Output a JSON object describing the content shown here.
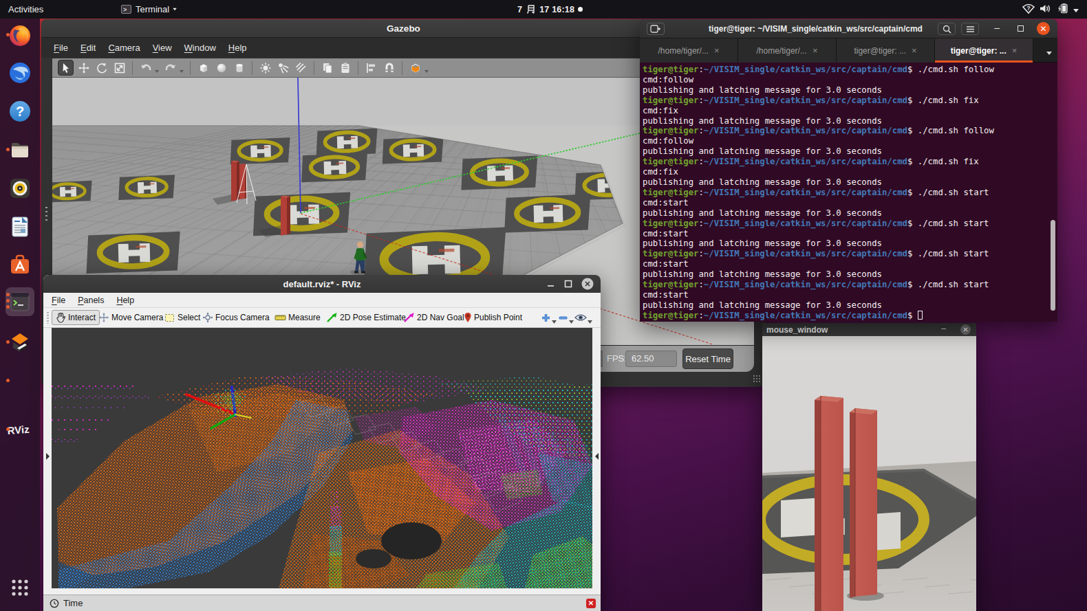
{
  "top_bar": {
    "activities": "Activities",
    "app_menu": {
      "icon": "terminal-icon",
      "label": "Terminal",
      "caret": "dropdown"
    },
    "clock": "7月 17 16:18",
    "recording_dot": true,
    "tray_icons": [
      "wifi-question-icon",
      "volume-icon",
      "battery-icon",
      "dropdown-caret-icon"
    ]
  },
  "dock": {
    "items": [
      {
        "id": "firefox",
        "icon": "firefox-icon",
        "running": true,
        "windows": 1,
        "active": false
      },
      {
        "id": "thunderbird",
        "icon": "thunderbird-icon",
        "running": false,
        "windows": 0,
        "active": false
      },
      {
        "id": "help",
        "icon": "help-icon",
        "running": false,
        "windows": 0,
        "active": false
      },
      {
        "id": "files",
        "icon": "files-icon",
        "running": true,
        "windows": 1,
        "active": false
      },
      {
        "id": "rhythmbox",
        "icon": "rhythmbox-icon",
        "running": false,
        "windows": 0,
        "active": false
      },
      {
        "id": "libreoffice-writer",
        "icon": "writer-icon",
        "running": false,
        "windows": 0,
        "active": false
      },
      {
        "id": "ubuntu-software",
        "icon": "software-icon",
        "running": false,
        "windows": 0,
        "active": false
      },
      {
        "id": "terminal",
        "icon": "terminal-app-icon",
        "running": true,
        "windows": 3,
        "active": true
      },
      {
        "id": "gazebo",
        "icon": "gazebo-icon",
        "running": true,
        "windows": 1,
        "active": false
      },
      {
        "id": "unknown-app",
        "icon": "blank-icon",
        "running": true,
        "windows": 1,
        "active": false
      },
      {
        "id": "rviz",
        "icon": "rviz-icon",
        "running": true,
        "windows": 1,
        "active": false
      }
    ],
    "show_apps_icon": "show-apps-grid-icon"
  },
  "gazebo_window": {
    "title": "Gazebo",
    "menus": [
      "File",
      "Edit",
      "Camera",
      "View",
      "Window",
      "Help"
    ],
    "toolbar_tools": [
      "select-arrow",
      "translate",
      "rotate",
      "scale",
      "sep",
      "undo",
      "drop",
      "redo",
      "drop",
      "sep",
      "box",
      "sphere",
      "cylinder",
      "sep",
      "point-light",
      "spot-light",
      "directional-light",
      "sep",
      "copy",
      "paste",
      "sep",
      "align",
      "snap",
      "sep",
      "view-angle",
      "drop"
    ],
    "selected_tool": "select-arrow",
    "status_bar": {
      "fps_label": "FPS:",
      "fps_value": "62.50",
      "reset_button": "Reset Time"
    }
  },
  "rviz_window": {
    "title": "default.rviz* - RViz",
    "window_buttons": [
      "minimize",
      "maximize",
      "close"
    ],
    "menus": [
      "File",
      "Panels",
      "Help"
    ],
    "tools": [
      {
        "label": "Interact",
        "icon": "hand-icon",
        "active": true
      },
      {
        "label": "Move Camera",
        "icon": "move-camera-icon",
        "active": false
      },
      {
        "label": "Select",
        "icon": "select-box-icon",
        "active": false
      },
      {
        "label": "Focus Camera",
        "icon": "focus-camera-icon",
        "active": false
      },
      {
        "label": "Measure",
        "icon": "measure-icon",
        "active": false
      },
      {
        "label": "2D Pose Estimate",
        "icon": "green-arrow-icon",
        "active": false
      },
      {
        "label": "2D Nav Goal",
        "icon": "magenta-arrow-icon",
        "active": false
      },
      {
        "label": "Publish Point",
        "icon": "publish-point-icon",
        "active": false
      }
    ],
    "toolbar_extra": [
      "add-tool-plus-icon",
      "remove-tool-minus-icon",
      "interaction-eye-icon"
    ],
    "time_panel": {
      "label": "Time",
      "icon": "clock-icon",
      "close_icon": "panel-close-icon"
    }
  },
  "terminal_window": {
    "header": {
      "title": "tiger@tiger: ~/VISIM_single/catkin_ws/src/captain/cmd",
      "buttons": [
        "new-tab",
        "search",
        "menu",
        "minimize",
        "maximize",
        "close"
      ]
    },
    "tabs": [
      {
        "label": "/home/tiger/...",
        "close": "×",
        "active": false
      },
      {
        "label": "/home/tiger/...",
        "close": "×",
        "active": false
      },
      {
        "label": "tiger@tiger: ...",
        "close": "×",
        "active": false
      },
      {
        "label": "tiger@tiger: ...",
        "close": "×",
        "active": true
      }
    ],
    "prompt": {
      "user": "tiger@tiger",
      "separator": ":",
      "path": "~/VISIM_single/catkin_ws/src/captain/cmd",
      "dollar": "$"
    },
    "entries": [
      {
        "command": "./cmd.sh follow",
        "echo": "cmd:follow",
        "publish": "publishing and latching message for 3.0 seconds"
      },
      {
        "command": "./cmd.sh fix",
        "echo": "cmd:fix",
        "publish": "publishing and latching message for 3.0 seconds"
      },
      {
        "command": "./cmd.sh follow",
        "echo": "cmd:follow",
        "publish": "publishing and latching message for 3.0 seconds"
      },
      {
        "command": "./cmd.sh fix",
        "echo": "cmd:fix",
        "publish": "publishing and latching message for 3.0 seconds"
      },
      {
        "command": "./cmd.sh start",
        "echo": "cmd:start",
        "publish": "publishing and latching message for 3.0 seconds"
      },
      {
        "command": "./cmd.sh start",
        "echo": "cmd:start",
        "publish": "publishing and latching message for 3.0 seconds"
      },
      {
        "command": "./cmd.sh start",
        "echo": "cmd:start",
        "publish": "publishing and latching message for 3.0 seconds"
      },
      {
        "command": "./cmd.sh start",
        "echo": "cmd:start",
        "publish": "publishing and latching message for 3.0 seconds"
      }
    ],
    "colors": {
      "user_host": "#71a32e",
      "path": "#4379b8",
      "text": "#f4eef1",
      "background": "#300a24",
      "active_tab_underline": "#e95420"
    }
  },
  "mouse_window": {
    "title": "mouse_window",
    "window_buttons": [
      "minimize",
      "close"
    ]
  },
  "desktop": {
    "wallpaper_colors": [
      "#c03530",
      "#97204e",
      "#661a5c",
      "#2b0a2e"
    ]
  }
}
